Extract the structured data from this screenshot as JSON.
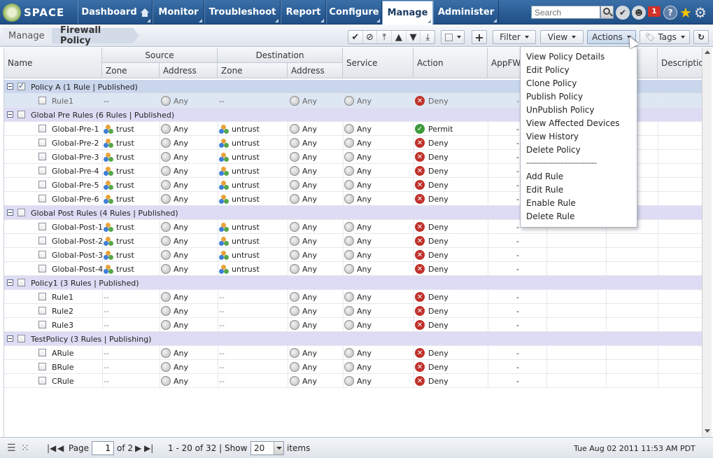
{
  "app": {
    "logo_text": "SPACE",
    "nav_tabs": [
      {
        "label": "Dashboard"
      },
      {
        "label": "Monitor"
      },
      {
        "label": "Troubleshoot"
      },
      {
        "label": "Report"
      },
      {
        "label": "Configure"
      },
      {
        "label": "Manage"
      },
      {
        "label": "Administer"
      }
    ],
    "active_tab": "Manage",
    "search": {
      "placeholder": "Search",
      "value": ""
    },
    "alert_count": "1",
    "help_label": "?"
  },
  "toolbar": {
    "breadcrumb": [
      "Manage",
      "Firewall Policy"
    ],
    "row_controls": [
      "✔",
      "⊘",
      "⤒",
      "▲",
      "▼",
      "⤓"
    ],
    "add_label": "+",
    "filter_label": "Filter",
    "view_label": "View",
    "actions_label": "Actions",
    "tags_label": "Tags",
    "refresh_label": "↻"
  },
  "grid": {
    "headers": {
      "name": "Name",
      "source": "Source",
      "destination": "Destination",
      "service": "Service",
      "action": "Action",
      "appfw": "AppFW",
      "description": "Description",
      "zone": "Zone",
      "address": "Address"
    },
    "rows": [
      {
        "type": "group",
        "label": "Policy A (1 Rule | Published)",
        "checked": true,
        "selected": true
      },
      {
        "type": "rule",
        "name": "Rule1",
        "src_zone": "--",
        "src_addr": "Any",
        "dst_zone": "--",
        "dst_addr": "Any",
        "service": "Any",
        "action": "Deny",
        "appfw": "-",
        "selected": true,
        "muted": true
      },
      {
        "type": "group",
        "label": "Global Pre Rules (6 Rules | Published)"
      },
      {
        "type": "rule",
        "name": "Global-Pre-1",
        "src_zone": "trust",
        "src_addr": "Any",
        "dst_zone": "untrust",
        "dst_addr": "Any",
        "service": "Any",
        "action": "Permit",
        "appfw": "-"
      },
      {
        "type": "rule",
        "name": "Global-Pre-2",
        "src_zone": "trust",
        "src_addr": "Any",
        "dst_zone": "untrust",
        "dst_addr": "Any",
        "service": "Any",
        "action": "Deny",
        "appfw": "-"
      },
      {
        "type": "rule",
        "name": "Global-Pre-3",
        "src_zone": "trust",
        "src_addr": "Any",
        "dst_zone": "untrust",
        "dst_addr": "Any",
        "service": "Any",
        "action": "Deny",
        "appfw": "-"
      },
      {
        "type": "rule",
        "name": "Global-Pre-4",
        "src_zone": "trust",
        "src_addr": "Any",
        "dst_zone": "untrust",
        "dst_addr": "Any",
        "service": "Any",
        "action": "Deny",
        "appfw": "-"
      },
      {
        "type": "rule",
        "name": "Global-Pre-5",
        "src_zone": "trust",
        "src_addr": "Any",
        "dst_zone": "untrust",
        "dst_addr": "Any",
        "service": "Any",
        "action": "Deny",
        "appfw": "-"
      },
      {
        "type": "rule",
        "name": "Global-Pre-6",
        "src_zone": "trust",
        "src_addr": "Any",
        "dst_zone": "untrust",
        "dst_addr": "Any",
        "service": "Any",
        "action": "Deny",
        "appfw": "-"
      },
      {
        "type": "group",
        "label": "Global Post Rules (4 Rules | Published)"
      },
      {
        "type": "rule",
        "name": "Global-Post-1",
        "src_zone": "trust",
        "src_addr": "Any",
        "dst_zone": "untrust",
        "dst_addr": "Any",
        "service": "Any",
        "action": "Deny",
        "appfw": "-"
      },
      {
        "type": "rule",
        "name": "Global-Post-2",
        "src_zone": "trust",
        "src_addr": "Any",
        "dst_zone": "untrust",
        "dst_addr": "Any",
        "service": "Any",
        "action": "Deny",
        "appfw": "-"
      },
      {
        "type": "rule",
        "name": "Global-Post-3",
        "src_zone": "trust",
        "src_addr": "Any",
        "dst_zone": "untrust",
        "dst_addr": "Any",
        "service": "Any",
        "action": "Deny",
        "appfw": "-"
      },
      {
        "type": "rule",
        "name": "Global-Post-4",
        "src_zone": "trust",
        "src_addr": "Any",
        "dst_zone": "untrust",
        "dst_addr": "Any",
        "service": "Any",
        "action": "Deny",
        "appfw": "-"
      },
      {
        "type": "group",
        "label": "Policy1 (3 Rules | Published)"
      },
      {
        "type": "rule",
        "name": "Rule1",
        "src_zone": "--",
        "src_addr": "Any",
        "dst_zone": "--",
        "dst_addr": "Any",
        "service": "Any",
        "action": "Deny",
        "appfw": "-"
      },
      {
        "type": "rule",
        "name": "Rule2",
        "src_zone": "--",
        "src_addr": "Any",
        "dst_zone": "--",
        "dst_addr": "Any",
        "service": "Any",
        "action": "Deny",
        "appfw": "-"
      },
      {
        "type": "rule",
        "name": "Rule3",
        "src_zone": "--",
        "src_addr": "Any",
        "dst_zone": "--",
        "dst_addr": "Any",
        "service": "Any",
        "action": "Deny",
        "appfw": "-"
      },
      {
        "type": "group",
        "label": "TestPolicy (3 Rules | Publishing)"
      },
      {
        "type": "rule",
        "name": "ARule",
        "src_zone": "--",
        "src_addr": "Any",
        "dst_zone": "--",
        "dst_addr": "Any",
        "service": "Any",
        "action": "Deny",
        "appfw": "-"
      },
      {
        "type": "rule",
        "name": "BRule",
        "src_zone": "--",
        "src_addr": "Any",
        "dst_zone": "--",
        "dst_addr": "Any",
        "service": "Any",
        "action": "Deny",
        "appfw": "-"
      },
      {
        "type": "rule",
        "name": "CRule",
        "src_zone": "--",
        "src_addr": "Any",
        "dst_zone": "--",
        "dst_addr": "Any",
        "service": "Any",
        "action": "Deny",
        "appfw": "-"
      }
    ]
  },
  "actions_menu": {
    "items": [
      "View Policy Details",
      "Edit Policy",
      "Clone Policy",
      "Publish Policy",
      "UnPublish Policy",
      "View Affected Devices",
      "View History",
      "Delete Policy",
      "-----------------------------",
      "Add Rule",
      "Edit Rule",
      "Enable Rule",
      "Delete Rule"
    ]
  },
  "footer": {
    "page_label": "Page",
    "page_value": "1",
    "of_label": "of 2",
    "range_label": "1 - 20 of 32 | Show",
    "show_value": "20",
    "items_label": "items",
    "timestamp": "Tue Aug 02 2011 11:53 AM PDT"
  },
  "colors": {
    "nav_bg": "#2a5d97",
    "group_row": "#dedcf5",
    "deny": "#c0312b",
    "permit": "#3a9a3a"
  }
}
